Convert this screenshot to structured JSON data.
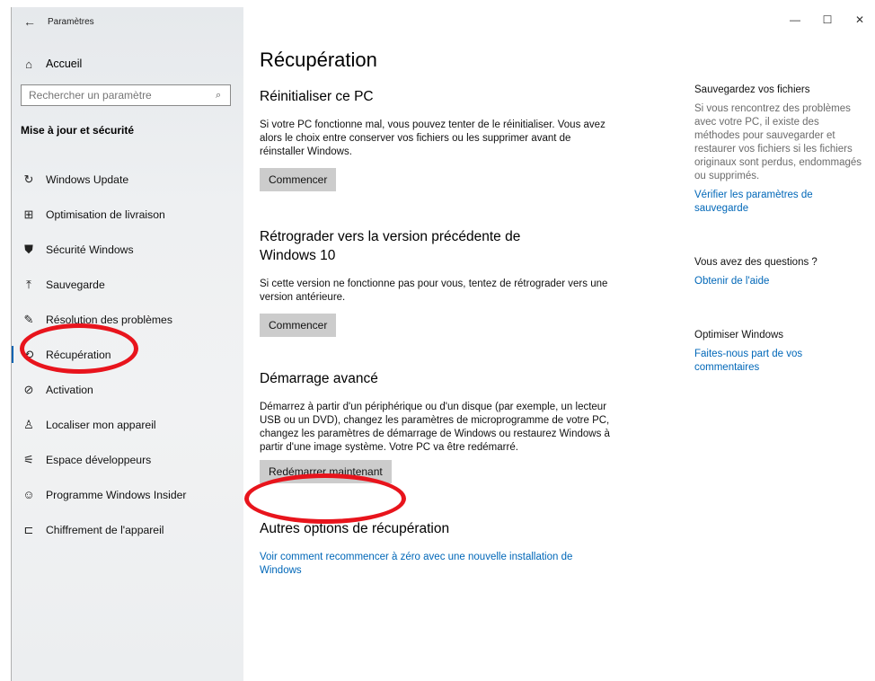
{
  "app": {
    "title": "Paramètres"
  },
  "window_controls": {
    "minimize": "—",
    "maximize": "☐",
    "close": "✕"
  },
  "sidebar": {
    "home": "Accueil",
    "search_placeholder": "Rechercher un paramètre",
    "section": "Mise à jour et sécurité",
    "items": [
      {
        "label": "Windows Update",
        "icon": "↻",
        "name": "sidebar-item-windows-update"
      },
      {
        "label": "Optimisation de livraison",
        "icon": "⊞",
        "name": "sidebar-item-delivery-optimization"
      },
      {
        "label": "Sécurité Windows",
        "icon": "⛊",
        "name": "sidebar-item-windows-security"
      },
      {
        "label": "Sauvegarde",
        "icon": "⤒",
        "name": "sidebar-item-backup"
      },
      {
        "label": "Résolution des problèmes",
        "icon": "✎",
        "name": "sidebar-item-troubleshoot"
      },
      {
        "label": "Récupération",
        "icon": "⟲",
        "name": "sidebar-item-recovery",
        "selected": true
      },
      {
        "label": "Activation",
        "icon": "⊘",
        "name": "sidebar-item-activation"
      },
      {
        "label": "Localiser mon appareil",
        "icon": "♙",
        "name": "sidebar-item-find-my-device"
      },
      {
        "label": "Espace développeurs",
        "icon": "⚟",
        "name": "sidebar-item-developers"
      },
      {
        "label": "Programme Windows Insider",
        "icon": "☺",
        "name": "sidebar-item-insider"
      },
      {
        "label": "Chiffrement de l'appareil",
        "icon": "⊏",
        "name": "sidebar-item-device-encryption"
      }
    ]
  },
  "main": {
    "title": "Récupération",
    "reset": {
      "heading": "Réinitialiser ce PC",
      "text": "Si votre PC fonctionne mal, vous pouvez tenter de le réinitialiser. Vous avez alors le choix entre conserver vos fichiers ou les supprimer avant de réinstaller Windows.",
      "button": "Commencer"
    },
    "rollback": {
      "heading": "Rétrograder vers la version précédente de Windows 10",
      "text": "Si cette version ne fonctionne pas pour vous, tentez de rétrograder vers une version antérieure.",
      "button": "Commencer"
    },
    "advanced": {
      "heading": "Démarrage avancé",
      "text": "Démarrez à partir d'un périphérique ou d'un disque (par exemple, un lecteur USB ou un DVD), changez les paramètres de microprogramme de votre PC, changez les paramètres de démarrage de Windows ou restaurez Windows à partir d'une image système. Votre PC va être redémarré.",
      "button": "Redémarrer maintenant"
    },
    "other": {
      "heading": "Autres options de récupération",
      "link": "Voir comment recommencer à zéro avec une nouvelle installation de Windows"
    }
  },
  "side": {
    "backup": {
      "heading": "Sauvegardez vos fichiers",
      "text": "Si vous rencontrez des problèmes avec votre PC, il existe des méthodes pour sauvegarder et restaurer vos fichiers si les fichiers originaux sont perdus, endommagés ou supprimés.",
      "link": "Vérifier les paramètres de sauvegarde"
    },
    "questions": {
      "heading": "Vous avez des questions ?",
      "link": "Obtenir de l'aide"
    },
    "improve": {
      "heading": "Optimiser Windows",
      "link": "Faites-nous part de vos commentaires"
    }
  },
  "colors": {
    "accent": "#0063b1",
    "link": "#0067b8",
    "annotation": "#e8141c",
    "button": "#cccccc"
  }
}
